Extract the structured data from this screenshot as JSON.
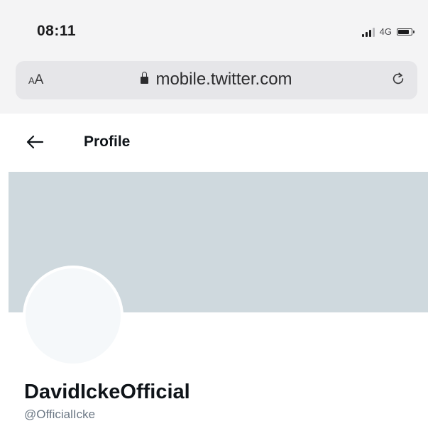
{
  "status_bar": {
    "time": "08:11",
    "network": "4G",
    "battery_fraction": 0.85
  },
  "browser": {
    "text_size_button": {
      "small": "A",
      "large": "A"
    },
    "url": "mobile.twitter.com",
    "icons": [
      "lock-icon",
      "reload-icon"
    ]
  },
  "header": {
    "title": "Profile",
    "back_icon": "back-arrow-icon"
  },
  "profile": {
    "display_name": "DavidIckeOfficial",
    "handle": "@OfficialIcke",
    "banner_color": "#cfd9de",
    "avatar_color": "#f5f8fa"
  }
}
